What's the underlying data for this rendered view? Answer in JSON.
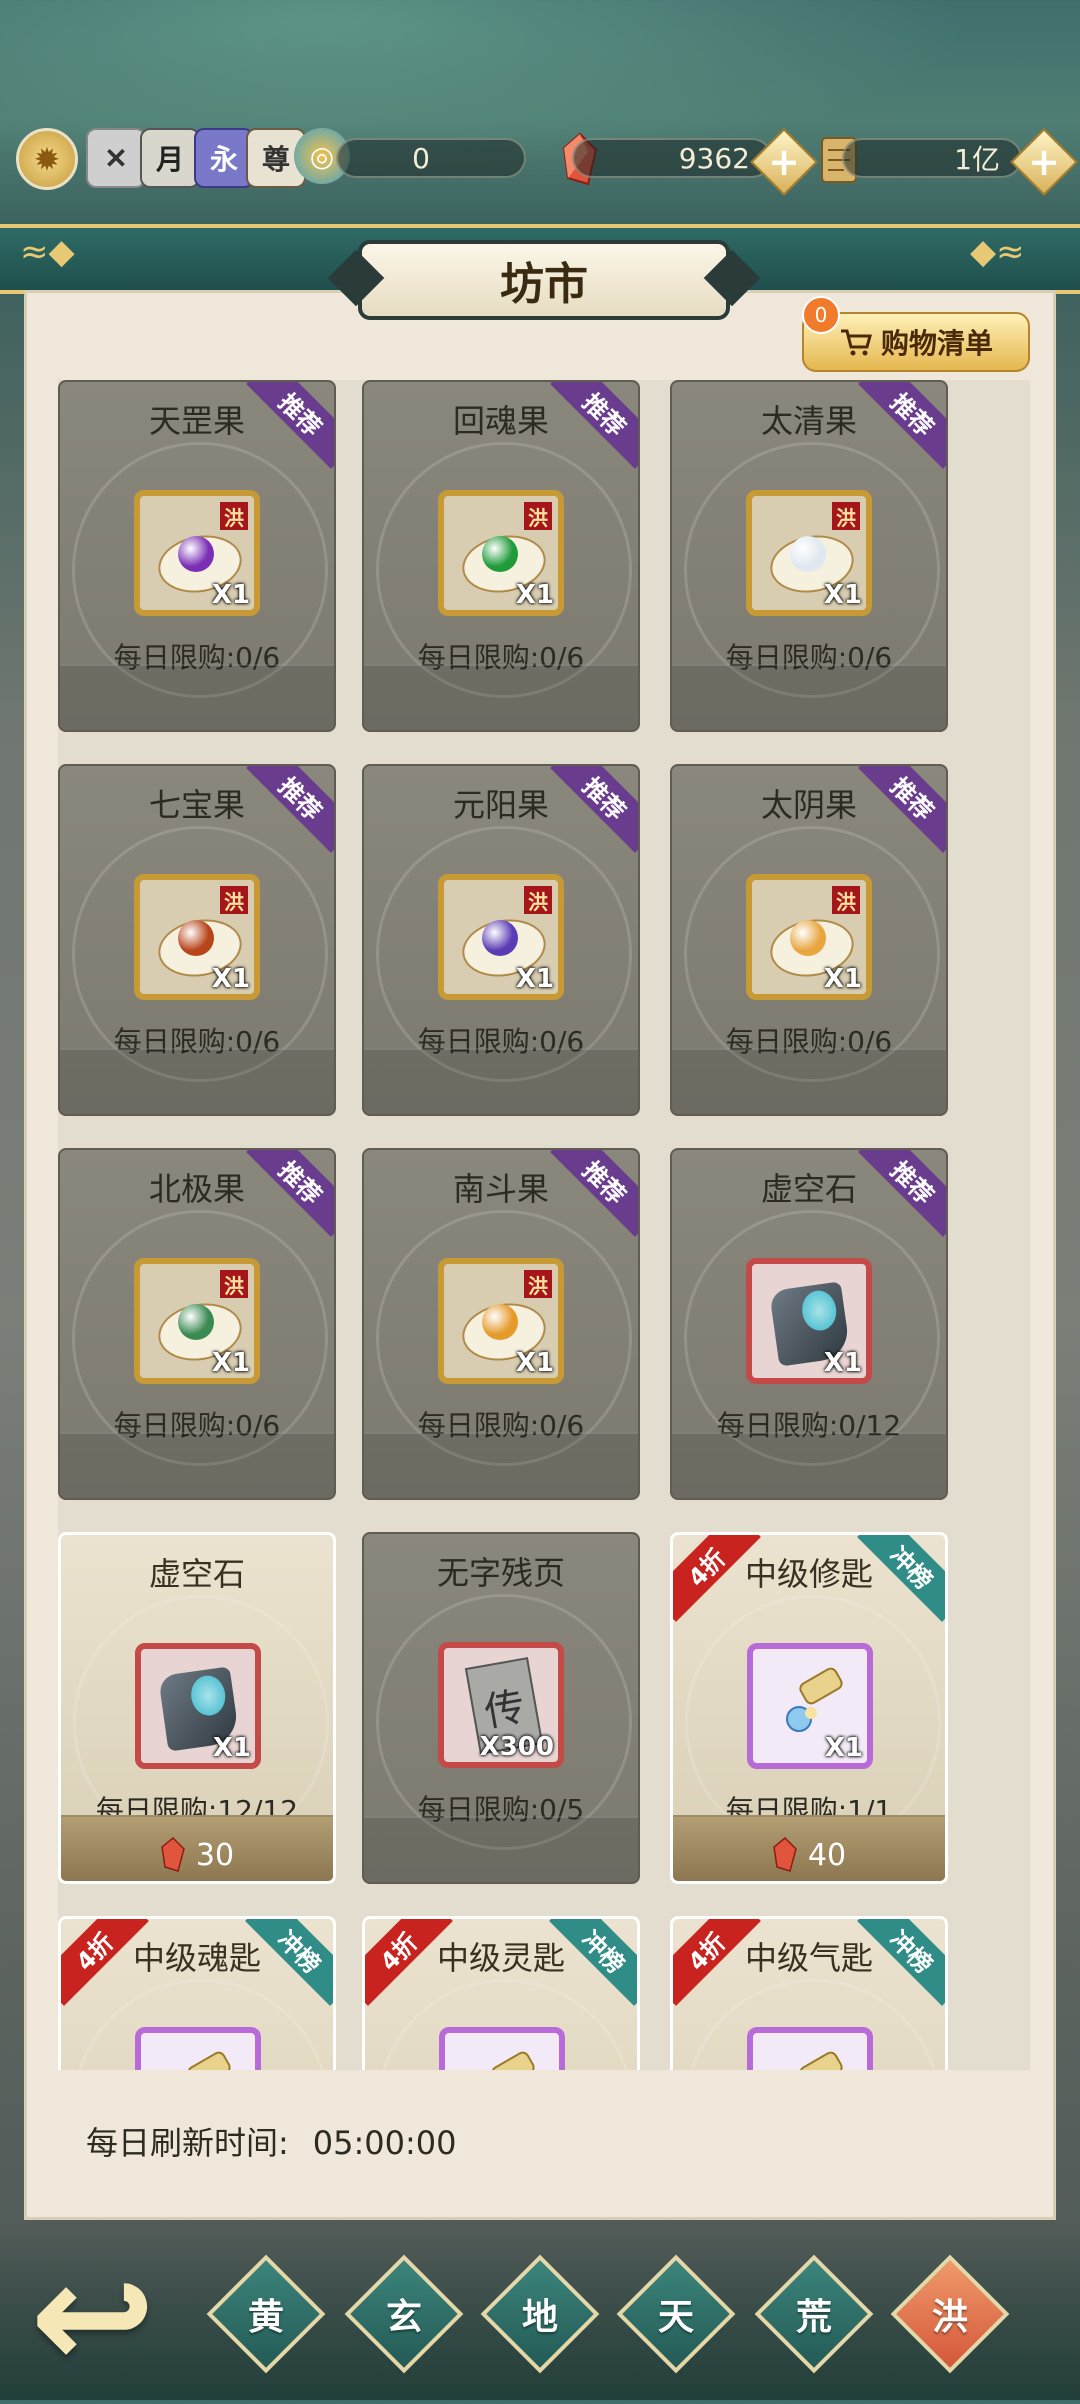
{
  "topbar": {
    "icons": [
      "gear-icon",
      "badge-icon",
      "yue-icon",
      "yong-icon",
      "zun-icon",
      "swirl-icon"
    ],
    "icon_glyphs": {
      "yue": "月",
      "yong": "永",
      "zun": "尊"
    },
    "resource1": "0",
    "gems": "9362",
    "scrolls": "1亿"
  },
  "panel": {
    "title": "坊市",
    "cart_badge": "0",
    "cart_label": "购物清单"
  },
  "cards": [
    {
      "name": "天罡果",
      "qty": "X1",
      "limit": "每日限购:0/6",
      "tag": "推荐",
      "tag_type": "rec",
      "frame": "gold",
      "fruit_color": "#7a2fb5"
    },
    {
      "name": "回魂果",
      "qty": "X1",
      "limit": "每日限购:0/6",
      "tag": "推荐",
      "tag_type": "rec",
      "frame": "gold",
      "fruit_color": "#1f9b3a"
    },
    {
      "name": "太清果",
      "qty": "X1",
      "limit": "每日限购:0/6",
      "tag": "推荐",
      "tag_type": "rec",
      "frame": "gold",
      "fruit_color": "#dfe8f0"
    },
    {
      "name": "七宝果",
      "qty": "X1",
      "limit": "每日限购:0/6",
      "tag": "推荐",
      "tag_type": "rec",
      "frame": "gold",
      "fruit_color": "#b8441a"
    },
    {
      "name": "元阳果",
      "qty": "X1",
      "limit": "每日限购:0/6",
      "tag": "推荐",
      "tag_type": "rec",
      "frame": "gold",
      "fruit_color": "#5b3cb5"
    },
    {
      "name": "太阴果",
      "qty": "X1",
      "limit": "每日限购:0/6",
      "tag": "推荐",
      "tag_type": "rec",
      "frame": "gold",
      "fruit_color": "#e8a640"
    },
    {
      "name": "北极果",
      "qty": "X1",
      "limit": "每日限购:0/6",
      "tag": "推荐",
      "tag_type": "rec",
      "frame": "gold",
      "fruit_color": "#3a8a52"
    },
    {
      "name": "南斗果",
      "qty": "X1",
      "limit": "每日限购:0/6",
      "tag": "推荐",
      "tag_type": "rec",
      "frame": "gold",
      "fruit_color": "#e59a2a"
    },
    {
      "name": "虚空石",
      "qty": "X1",
      "limit": "每日限购:0/12",
      "tag": "推荐",
      "tag_type": "rec",
      "frame": "red",
      "item": "stone"
    },
    {
      "name": "虚空石",
      "qty": "X1",
      "limit": "每日限购:12/12",
      "price": "30",
      "active": true,
      "frame": "red",
      "item": "stone"
    },
    {
      "name": "无字残页",
      "qty": "X300",
      "limit": "每日限购:0/5",
      "frame": "red",
      "item": "page",
      "page_glyph": "传"
    },
    {
      "name": "中级修匙",
      "qty": "X1",
      "limit": "每日限购:1/1",
      "price": "40",
      "active": true,
      "frame": "purple",
      "item": "key",
      "disc": "4折",
      "tag": "冲榜",
      "tag_type": "rank"
    },
    {
      "name": "中级魂匙",
      "disc": "4折",
      "tag": "冲榜",
      "tag_type": "rank",
      "active": true,
      "frame": "purple",
      "item": "key"
    },
    {
      "name": "中级灵匙",
      "disc": "4折",
      "tag": "冲榜",
      "tag_type": "rank",
      "active": true,
      "frame": "purple",
      "item": "key"
    },
    {
      "name": "中级气匙",
      "disc": "4折",
      "tag": "冲榜",
      "tag_type": "rank",
      "active": true,
      "frame": "purple",
      "item": "key"
    }
  ],
  "footer": {
    "refresh_label": "每日刷新时间:",
    "refresh_time": "05:00:00"
  },
  "nav": {
    "tabs": [
      "黄",
      "玄",
      "地",
      "天",
      "荒",
      "洪"
    ],
    "selected": "洪"
  }
}
